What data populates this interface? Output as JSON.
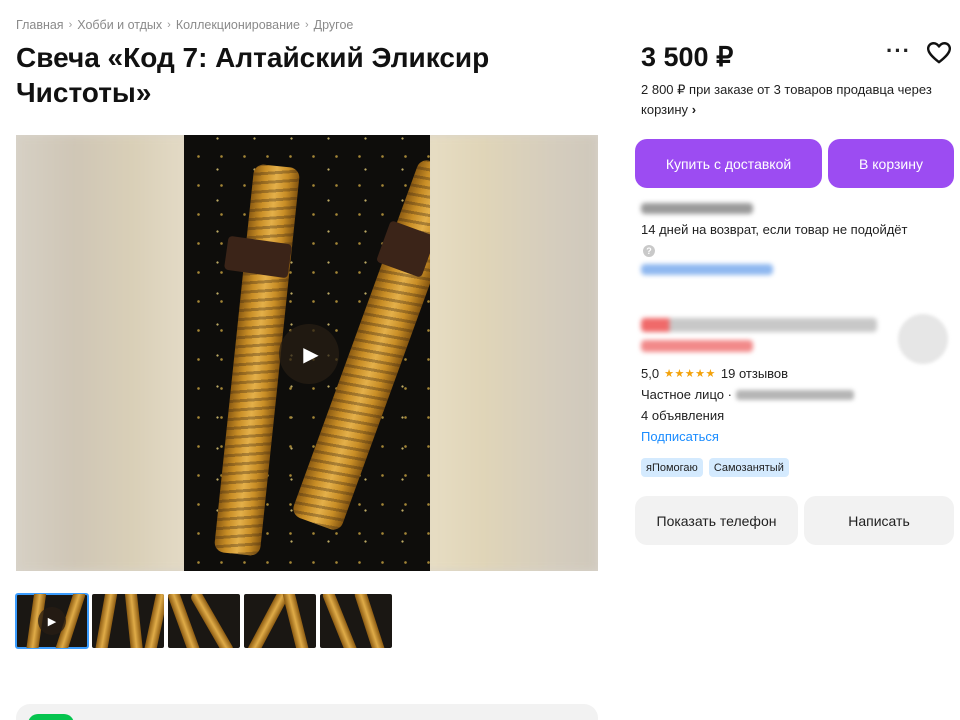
{
  "breadcrumb": [
    "Главная",
    "Хобби и отдых",
    "Коллекционирование",
    "Другое"
  ],
  "breadcrumb_sep": "›",
  "listing": {
    "title": "Свеча «Код 7: Алтайский Эликсир Чистоты»",
    "price": "3 500 ₽",
    "promo": "2 800 ₽ при заказе от 3 товаров продавца через корзину",
    "promo_chevron": "›"
  },
  "actions": {
    "more": "···",
    "buy_label": "Купить с доставкой",
    "cart_label": "В корзину",
    "phone_label": "Показать телефон",
    "write_label": "Написать"
  },
  "delivery": {
    "return_text": "14 дней на возврат, если товар не подойдёт",
    "info_glyph": "?"
  },
  "seller": {
    "rating_value": "5,0",
    "stars": "★★★★★",
    "reviews": "19 отзывов",
    "type": "Частное лицо ·",
    "ads_count": "4 объявления",
    "subscribe": "Подписаться",
    "badges": [
      "яПомогаю",
      "Самозанятый"
    ]
  },
  "gallery": {
    "play_glyph": "▶",
    "thumbnail_count": 5
  },
  "colors": {
    "accent": "#9c4cf2",
    "link": "#1a8cff",
    "star": "#f3a20b",
    "badge_bg": "#d4eafe"
  }
}
